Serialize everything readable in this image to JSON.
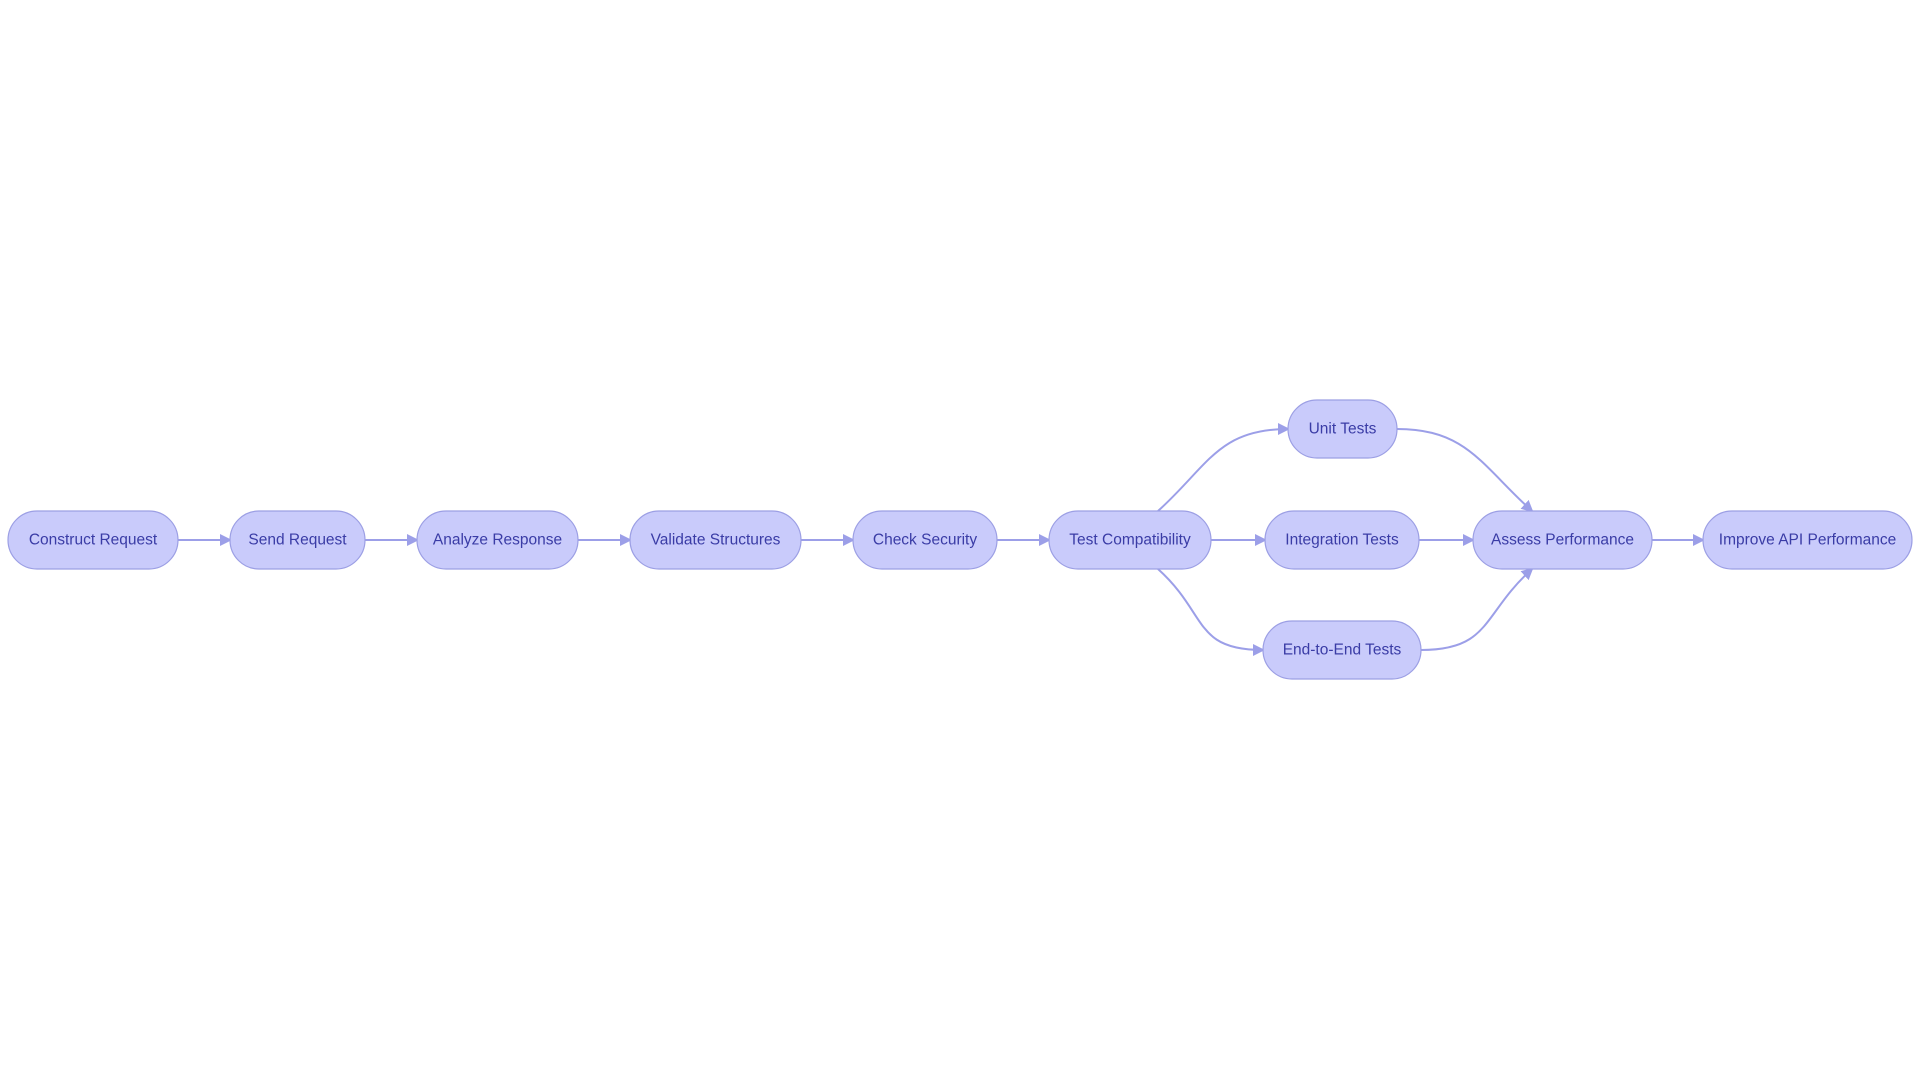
{
  "diagram": {
    "type": "flowchart",
    "direction": "left-to-right",
    "colors": {
      "node_fill": "#c9cbfb",
      "node_stroke": "#9c9fe4",
      "node_text": "#3a3ca6",
      "edge": "#9c9fe8",
      "background": "#ffffff"
    },
    "nodes": [
      {
        "id": "construct",
        "label": "Construct Request"
      },
      {
        "id": "send",
        "label": "Send Request"
      },
      {
        "id": "analyze",
        "label": "Analyze Response"
      },
      {
        "id": "validate",
        "label": "Validate Structures"
      },
      {
        "id": "security",
        "label": "Check Security"
      },
      {
        "id": "compat",
        "label": "Test Compatibility"
      },
      {
        "id": "unit",
        "label": "Unit Tests"
      },
      {
        "id": "integration",
        "label": "Integration Tests"
      },
      {
        "id": "e2e",
        "label": "End-to-End Tests"
      },
      {
        "id": "assess",
        "label": "Assess Performance"
      },
      {
        "id": "improve",
        "label": "Improve API Performance"
      }
    ],
    "edges": [
      {
        "from": "construct",
        "to": "send"
      },
      {
        "from": "send",
        "to": "analyze"
      },
      {
        "from": "analyze",
        "to": "validate"
      },
      {
        "from": "validate",
        "to": "security"
      },
      {
        "from": "security",
        "to": "compat"
      },
      {
        "from": "compat",
        "to": "unit"
      },
      {
        "from": "compat",
        "to": "integration"
      },
      {
        "from": "compat",
        "to": "e2e"
      },
      {
        "from": "unit",
        "to": "assess"
      },
      {
        "from": "integration",
        "to": "assess"
      },
      {
        "from": "e2e",
        "to": "assess"
      },
      {
        "from": "assess",
        "to": "improve"
      }
    ]
  }
}
